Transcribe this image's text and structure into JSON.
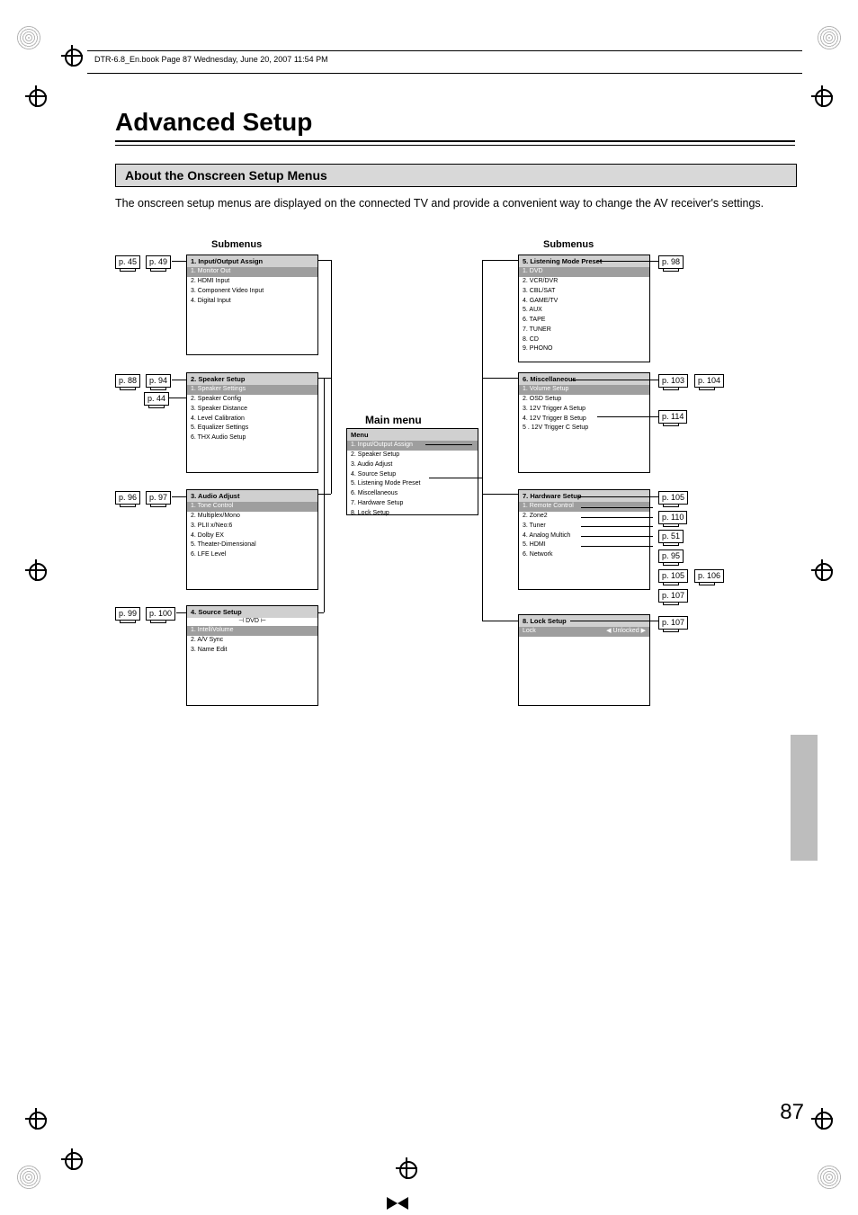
{
  "header_text": "DTR-6.8_En.book  Page 87  Wednesday, June 20, 2007  11:54 PM",
  "main_title": "Advanced Setup",
  "section_title": "About the Onscreen Setup Menus",
  "intro_text": "The onscreen setup menus are displayed on the connected TV and provide a convenient way to change the AV receiver's settings.",
  "submenus_label": "Submenus",
  "main_menu_label": "Main menu",
  "page_number": "87",
  "main_menu": {
    "title": "Menu",
    "items": [
      "1.   Input/Output Assign",
      "2.   Speaker Setup",
      "3.   Audio Adjust",
      "4.   Source Setup",
      "5.   Listening Mode Preset",
      "6.   Miscellaneous",
      "7.   Hardware Setup",
      "8.   Lock Setup"
    ]
  },
  "panels": [
    {
      "title": "1.   Input/Output Assign",
      "hilite": "1.   Monitor Out",
      "items": [
        "2.   HDMI Input",
        "3.   Component Video Input",
        "4.   Digital Input"
      ]
    },
    {
      "title": "2.   Speaker Setup",
      "hilite": "1.   Speaker Settings",
      "items": [
        "2.   Speaker Config",
        "3.   Speaker Distance",
        "4.   Level Calibration",
        "5.   Equalizer Settings",
        "6.   THX Audio Setup"
      ]
    },
    {
      "title": "3.   Audio Adjust",
      "hilite": "1.   Tone Control",
      "items": [
        "2.   Multiplex/Mono",
        "3.   PLII x/Neo:6",
        "4.   Dolby EX",
        "5.   Theater-Dimensional",
        "6.   LFE Level"
      ]
    },
    {
      "title": "4.   Source Setup",
      "subtitle": "DVD",
      "hilite": "1.   IntelliVolume",
      "items": [
        "2.   A/V Sync",
        "3.   Name Edit"
      ]
    },
    {
      "title": "5.   Listening Mode Preset",
      "hilite": "1.   DVD",
      "items": [
        "2.   VCR/DVR",
        "3.   CBL/SAT",
        "4.   GAME/TV",
        "5.   AUX",
        "6.   TAPE",
        "7.   TUNER",
        "8.   CD",
        "9.   PHONO"
      ]
    },
    {
      "title": "6.   Miscellaneous",
      "hilite": "1.   Volume Setup",
      "items": [
        "2.   OSD Setup",
        "3.   12V Trigger A Setup",
        "4.   12V Trigger B Setup",
        "5 .  12V Trigger C Setup"
      ]
    },
    {
      "title": "7.   Hardware Setup",
      "hilite": "1.   Remote Control",
      "items": [
        "2.   Zone2",
        "3.   Tuner",
        "4.   Analog Multich",
        "5.   HDMI",
        "6.   Network"
      ]
    },
    {
      "title": "8.   Lock Setup",
      "hilite": "Lock",
      "hilite_right": "◀  Unlocked  ▶",
      "items": []
    }
  ],
  "page_refs": {
    "p45": "p. 45",
    "p49": "p. 49",
    "p88": "p. 88",
    "p94": "p. 94",
    "p44": "p. 44",
    "p96": "p. 96",
    "p97": "p. 97",
    "p99": "p. 99",
    "p100": "p. 100",
    "p98": "p. 98",
    "p103": "p. 103",
    "p104": "p. 104",
    "p114": "p. 114",
    "p105": "p. 105",
    "p110": "p. 110",
    "p51": "p. 51",
    "p95": "p. 95",
    "p105b": "p. 105",
    "p106": "p. 106",
    "p107a": "p. 107",
    "p107b": "p. 107"
  }
}
